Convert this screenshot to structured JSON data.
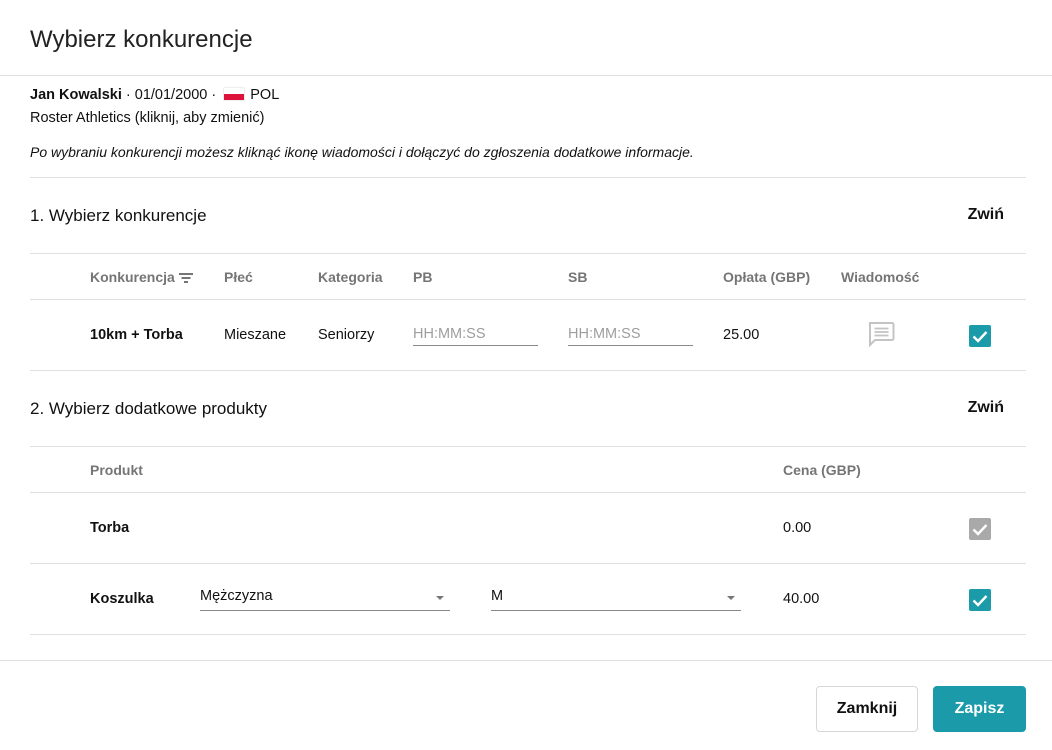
{
  "dialog": {
    "title": "Wybierz konkurencje"
  },
  "athlete": {
    "name": "Jan Kowalski",
    "dob": "01/01/2000",
    "country": "POL",
    "club": "Roster Athletics (kliknij, aby zmienić)",
    "info": "Po wybraniu konkurencji możesz kliknąć ikonę wiadomości i dołączyć do zgłoszenia dodatkowe informacje."
  },
  "events_section": {
    "title": "1. Wybierz konkurencje",
    "collapse_label": "Zwiń",
    "headers": {
      "event": "Konkurencja",
      "gender": "Płeć",
      "category": "Kategoria",
      "pb": "PB",
      "sb": "SB",
      "fee": "Opłata (GBP)",
      "message": "Wiadomość"
    },
    "rows": [
      {
        "event": "10km + Torba",
        "gender": "Mieszane",
        "category": "Seniorzy",
        "pb_placeholder": "HH:MM:SS",
        "sb_placeholder": "HH:MM:SS",
        "fee": "25.00",
        "message_icon": "chat-bubble-icon",
        "checked": true
      }
    ]
  },
  "products_section": {
    "title": "2. Wybierz dodatkowe produkty",
    "collapse_label": "Zwiń",
    "headers": {
      "product": "Produkt",
      "price": "Cena (GBP)"
    },
    "rows": [
      {
        "product": "Torba",
        "price": "0.00",
        "checked": true,
        "disabled": true
      },
      {
        "product": "Koszulka",
        "option1": "Mężczyzna",
        "option2": "M",
        "price": "40.00",
        "checked": true,
        "disabled": false
      }
    ]
  },
  "footer": {
    "close_label": "Zamknij",
    "save_label": "Zapisz"
  },
  "colors": {
    "accent": "#1b9aaa",
    "disabled": "#a9a9a9",
    "header_text": "#757575",
    "divider": "#e0e0e0"
  }
}
